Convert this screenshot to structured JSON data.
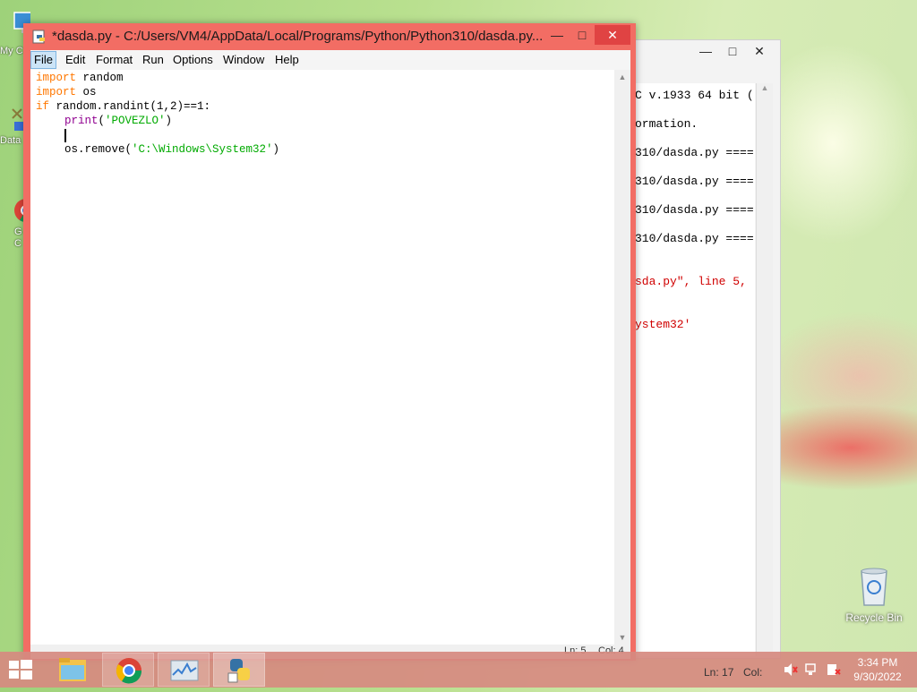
{
  "desktop": {
    "icons": [
      {
        "label": "My C",
        "name": "my-computer"
      },
      {
        "label": "Data",
        "name": "data"
      },
      {
        "label": "G\nC",
        "name": "google-chrome"
      }
    ],
    "recycle_bin_label": "Recycle Bin"
  },
  "shell_window": {
    "lines": [
      {
        "text": "C v.1933 64 bit (",
        "color": "black"
      },
      {
        "text": "ormation.",
        "color": "black"
      },
      {
        "text": "310/dasda.py ====",
        "color": "black"
      },
      {
        "text": "310/dasda.py ====",
        "color": "black"
      },
      {
        "text": "310/dasda.py ====",
        "color": "black"
      },
      {
        "text": "310/dasda.py ====",
        "color": "black"
      },
      {
        "text": "sda.py\", line 5,",
        "color": "red"
      },
      {
        "text": "ystem32'",
        "color": "red"
      }
    ],
    "status_ln": "Ln: 17",
    "status_col": "Col: "
  },
  "editor": {
    "title": "*dasda.py - C:/Users/VM4/AppData/Local/Programs/Python/Python310/dasda.py...",
    "menu": [
      "File",
      "Edit",
      "Format",
      "Run",
      "Options",
      "Window",
      "Help"
    ],
    "active_menu": "File",
    "code": {
      "l1_kw": "import",
      "l1_rest": " random",
      "l2_kw": "import",
      "l2_rest": " os",
      "l3_kw": "if",
      "l3_rest": " random.randint(1,2)==1:",
      "l4_kw": "print",
      "l4_open": "(",
      "l4_str": "'POVEZLO'",
      "l4_close": ")",
      "l6_pre": "os.remove(",
      "l6_str": "'C:\\Windows\\System32'",
      "l6_close": ")"
    },
    "status_ln": "Ln: 5",
    "status_col": "Col: 4"
  },
  "taskbar": {
    "apps": [
      "file-explorer",
      "google-chrome",
      "task-manager",
      "python-idle"
    ],
    "time": "3:34 PM",
    "date": "9/30/2022"
  }
}
